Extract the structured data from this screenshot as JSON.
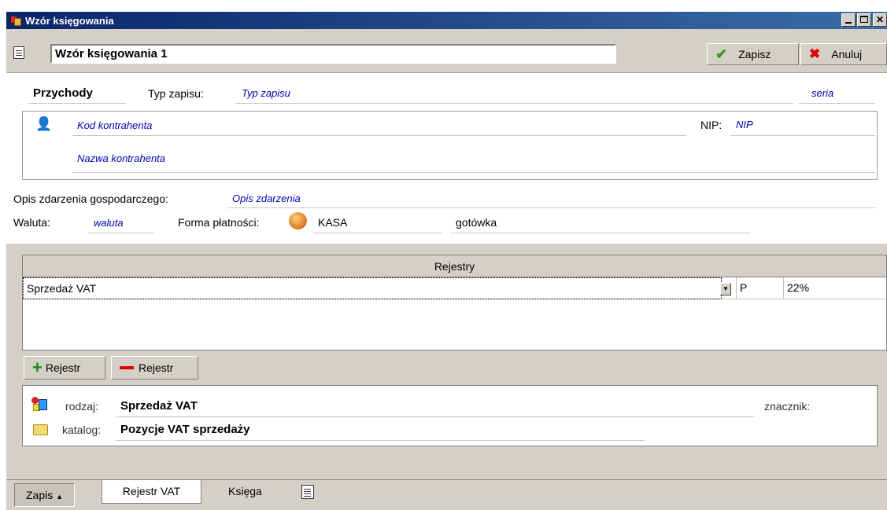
{
  "window": {
    "title": "Wzór księgowania"
  },
  "toolbar": {
    "name_value": "Wzór księgowania 1",
    "save_label": "Zapisz",
    "cancel_label": "Anuluj"
  },
  "header": {
    "section": "Przychody",
    "entry_type_label": "Typ zapisu:",
    "entry_type_value": "Typ zapisu",
    "series_value": "seria"
  },
  "contractor": {
    "code_value": "Kod kontrahenta",
    "nip_label": "NIP:",
    "nip_value": "NIP",
    "name_value": "Nazwa kontrahenta"
  },
  "event": {
    "label": "Opis zdarzenia gospodarczego:",
    "value": "Opis zdarzenia"
  },
  "currency": {
    "label": "Waluta:",
    "value": "waluta"
  },
  "payment": {
    "label": "Forma płatności:",
    "cashbox": "KASA",
    "method": "gotówka"
  },
  "registers": {
    "header": "Rejestry",
    "rows": [
      {
        "name": "Sprzedaż VAT",
        "type": "P",
        "rate": "22%"
      }
    ],
    "add_label": "Rejestr",
    "remove_label": "Rejestr"
  },
  "details": {
    "kind_label": "rodzaj:",
    "kind_value": "Sprzedaż VAT",
    "marker_label": "znacznik:",
    "catalog_label": "katalog:",
    "catalog_value": "Pozycje VAT sprzedaży"
  },
  "tabs": {
    "zapis": "Zapis",
    "rejestr_vat": "Rejestr VAT",
    "ksiega": "Księga"
  },
  "colors": {
    "title_bar": "#0a246a",
    "face": "#d4d0c8",
    "italic_value": "#0000b0"
  }
}
